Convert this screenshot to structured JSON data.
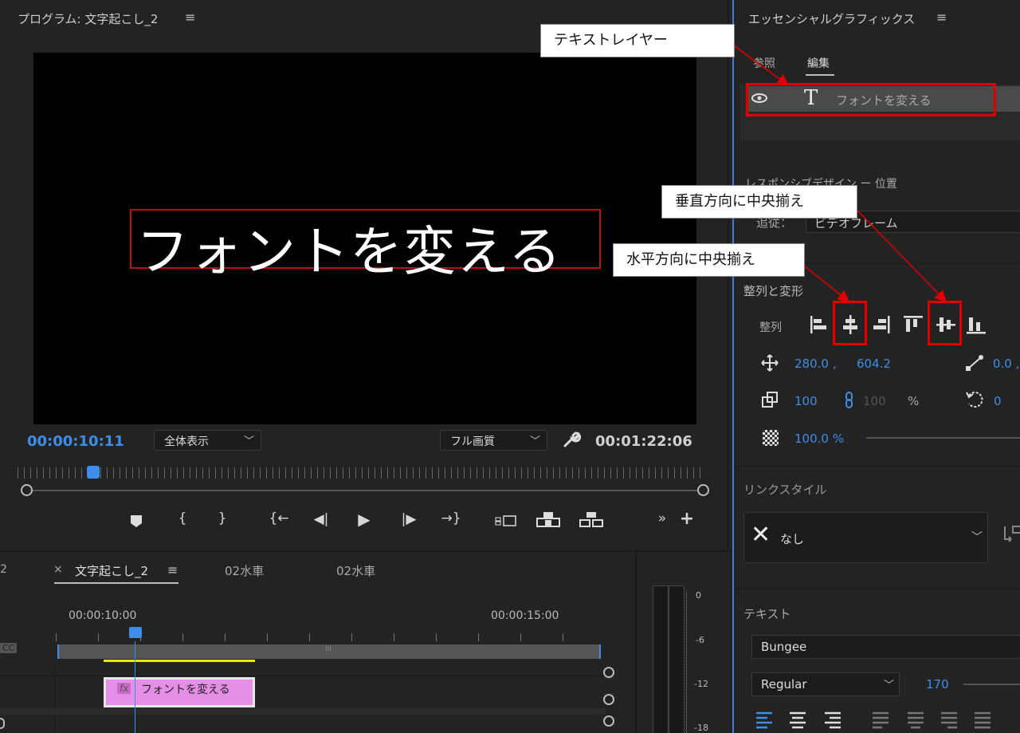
{
  "program_monitor": {
    "title": "プログラム: 文字起こし_2",
    "menu_glyph": "≡",
    "preview_text": "フォントを変える",
    "current_time": "00:00:10:11",
    "zoom_select": "全体表示",
    "quality_select": "フル画質",
    "duration": "00:01:22:06",
    "playhead_fraction": 0.11
  },
  "transport": {
    "buttons": [
      "marker-icon",
      "mark-in-icon",
      "mark-out-icon",
      "go-to-in-icon",
      "step-back-icon",
      "play-icon",
      "step-forward-icon",
      "go-to-out-icon",
      "safe-margins-icon",
      "lift-icon",
      "extract-icon",
      "more-icon",
      "add-button-icon"
    ]
  },
  "timeline": {
    "left_tab_fragment": "2",
    "close_glyph": "×",
    "tab_active": "文字起こし_2",
    "tab_menu_glyph": "≡",
    "tab_2": "02水車",
    "tab_3": "02水車",
    "time_ruler": [
      "00:00:10:00",
      "00:00:15:00"
    ],
    "cc_label": "CC",
    "clip_fx": "fx",
    "clip_label": "フォントを変える",
    "work_area_glyph": "III"
  },
  "audio_meter": {
    "labels": [
      "0",
      "-6",
      "-12",
      "-18"
    ]
  },
  "essential_graphics": {
    "title": "エッセンシャルグラフィックス",
    "menu_glyph": "≡",
    "tabs": [
      "参照",
      "編集"
    ],
    "layer_name": "フォントを変える",
    "responsive_label": "レスポンシブデザイン ー 位置",
    "follow_label": "追従：",
    "follow_value": "ビデオフレーム",
    "align_section": "整列と変形",
    "align_label": "整列",
    "position_x": "280.0",
    "position_sep": ",",
    "position_y": "604.2",
    "anchor_value": "0.0 ,",
    "scale_value": "100",
    "scale_linked_value": "100",
    "percent": "%",
    "rotation_value": "0",
    "opacity_value": "100.0 %",
    "link_style_label": "リンクスタイル",
    "link_style_value": "なし",
    "text_section": "テキスト",
    "font_family": "Bungee",
    "font_style": "Regular",
    "font_size": "170"
  },
  "callouts": {
    "text_layer": "テキストレイヤー",
    "vertical_center": "垂直方向に中央揃え",
    "horizontal_center": "水平方向に中央揃え"
  },
  "colors": {
    "accent_blue": "#3d8ee8",
    "annotation_red": "#e00000",
    "clip_pink": "#e58ee6",
    "in_out_yellow": "#e8e800"
  }
}
